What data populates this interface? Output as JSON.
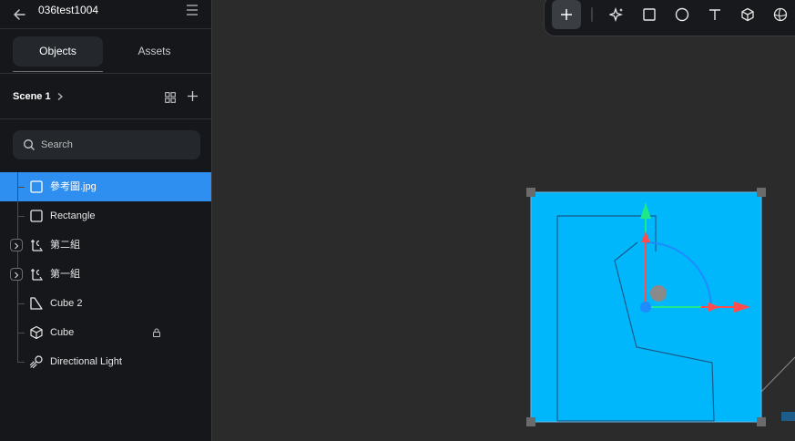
{
  "app": {
    "project_name": "036test1004"
  },
  "tabs": [
    {
      "label": "Objects",
      "active": true
    },
    {
      "label": "Assets",
      "active": false
    }
  ],
  "scene": {
    "name": "Scene 1"
  },
  "search": {
    "placeholder": "Search",
    "value": ""
  },
  "layers": [
    {
      "label": "參考圖.jpg",
      "icon": "frame-icon",
      "selected": true,
      "expandable": false,
      "locked": false
    },
    {
      "label": "Rectangle",
      "icon": "rectangle-icon",
      "selected": false,
      "expandable": false,
      "locked": false
    },
    {
      "label": "第二組",
      "icon": "component-icon",
      "selected": false,
      "expandable": true,
      "locked": false
    },
    {
      "label": "第一組",
      "icon": "component-icon",
      "selected": false,
      "expandable": true,
      "locked": false
    },
    {
      "label": "Cube 2",
      "icon": "shape-icon",
      "selected": false,
      "expandable": false,
      "locked": false
    },
    {
      "label": "Cube",
      "icon": "cube-icon",
      "selected": false,
      "expandable": false,
      "locked": true
    },
    {
      "label": "Directional Light",
      "icon": "light-icon",
      "selected": false,
      "expandable": false,
      "locked": false
    }
  ],
  "toolbar": {
    "tools": [
      "add",
      "ai-sparkle",
      "rectangle",
      "ellipse",
      "text",
      "cube",
      "sphere"
    ],
    "active_tool": "add"
  },
  "colors": {
    "selection": "#2f8ff0",
    "image_fill": "#00b7fb",
    "gizmo_x": "#ff4d4d",
    "gizmo_y": "#1ee88a",
    "gizmo_z": "#1e8bff"
  }
}
